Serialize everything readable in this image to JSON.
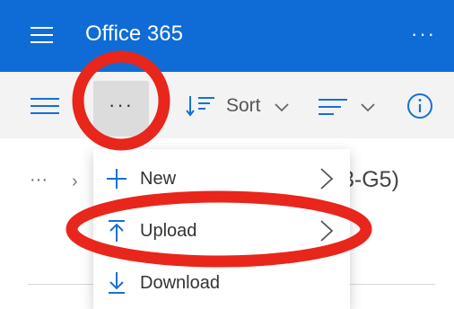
{
  "app": {
    "title": "Office 365"
  },
  "topbar": {
    "more_label": "···"
  },
  "toolbar": {
    "more_label": "···",
    "sort_label": "Sort"
  },
  "breadcrumb": {
    "ellipsis": "···",
    "separator": "›",
    "current_partial": "3-G5)"
  },
  "menu": {
    "items": [
      {
        "label": "New",
        "icon": "plus-icon",
        "has_submenu": true
      },
      {
        "label": "Upload",
        "icon": "upload-icon",
        "has_submenu": true
      },
      {
        "label": "Download",
        "icon": "download-icon",
        "has_submenu": false
      }
    ]
  },
  "colors": {
    "accent": "#0f6cd6",
    "icon_blue": "#1570d6",
    "annotation_red": "#e8261c"
  }
}
